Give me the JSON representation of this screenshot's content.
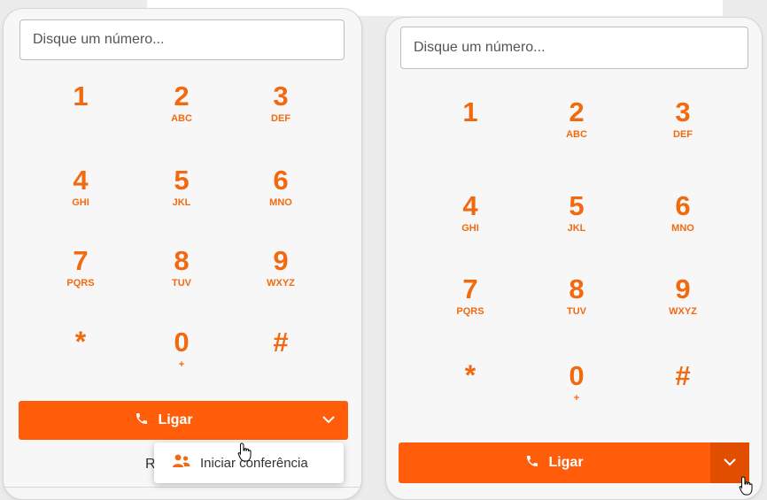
{
  "colors": {
    "accent": "#f26a10",
    "call_bar": "#ff5d0a",
    "call_toggle_hover": "#e24e00"
  },
  "left_panel": {
    "search": {
      "value": "",
      "placeholder": "Disque um número..."
    },
    "keypad": [
      {
        "digit": "1",
        "letters": ""
      },
      {
        "digit": "2",
        "letters": "ABC"
      },
      {
        "digit": "3",
        "letters": "DEF"
      },
      {
        "digit": "4",
        "letters": "GHI"
      },
      {
        "digit": "5",
        "letters": "JKL"
      },
      {
        "digit": "6",
        "letters": "MNO"
      },
      {
        "digit": "7",
        "letters": "PQRS"
      },
      {
        "digit": "8",
        "letters": "TUV"
      },
      {
        "digit": "9",
        "letters": "WXYZ"
      },
      {
        "digit": "*",
        "letters": ""
      },
      {
        "digit": "0",
        "letters": "+"
      },
      {
        "digit": "#",
        "letters": ""
      }
    ],
    "call_button": {
      "label": "Ligar",
      "icon": "phone-icon"
    },
    "dropdown_toggle_icon": "chevron-down-icon",
    "below_text": "R",
    "menu": {
      "items": [
        {
          "label": "Iniciar conferência",
          "icon": "users-icon"
        }
      ]
    }
  },
  "right_panel": {
    "search": {
      "value": "",
      "placeholder": "Disque um número..."
    },
    "keypad": [
      {
        "digit": "1",
        "letters": ""
      },
      {
        "digit": "2",
        "letters": "ABC"
      },
      {
        "digit": "3",
        "letters": "DEF"
      },
      {
        "digit": "4",
        "letters": "GHI"
      },
      {
        "digit": "5",
        "letters": "JKL"
      },
      {
        "digit": "6",
        "letters": "MNO"
      },
      {
        "digit": "7",
        "letters": "PQRS"
      },
      {
        "digit": "8",
        "letters": "TUV"
      },
      {
        "digit": "9",
        "letters": "WXYZ"
      },
      {
        "digit": "*",
        "letters": ""
      },
      {
        "digit": "0",
        "letters": "+"
      },
      {
        "digit": "#",
        "letters": ""
      }
    ],
    "call_button": {
      "label": "Ligar",
      "icon": "phone-icon"
    },
    "dropdown_toggle_icon": "chevron-down-icon"
  }
}
